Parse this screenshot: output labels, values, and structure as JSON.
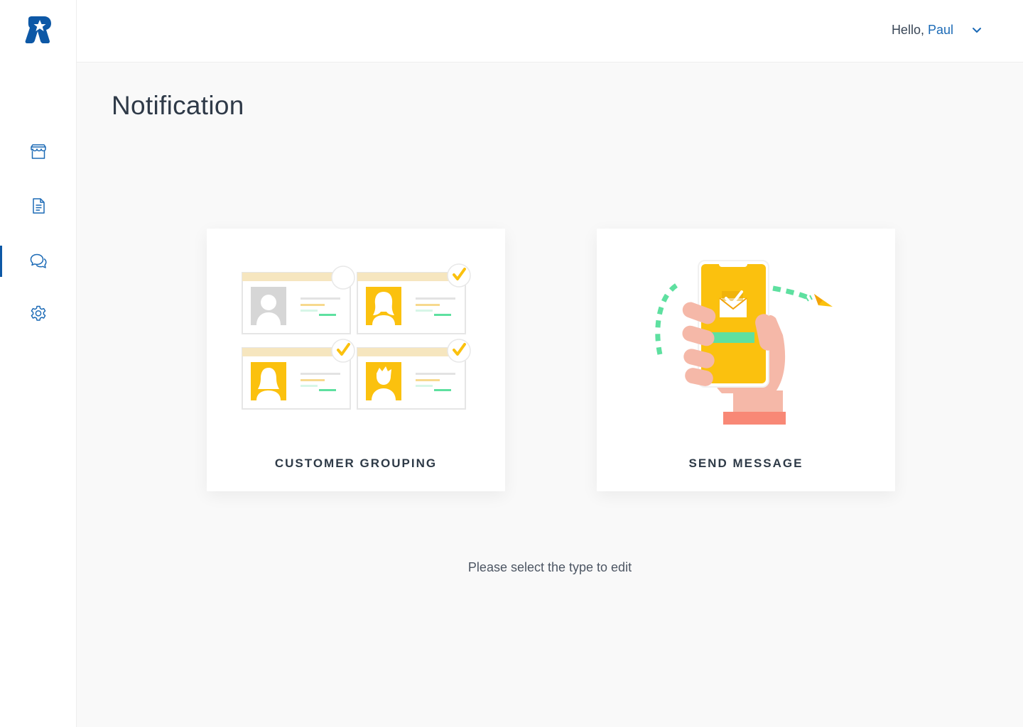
{
  "sidebar": {
    "logo_icon": "brand-star-logo",
    "items": [
      {
        "name": "store",
        "icon": "store-icon",
        "active": false
      },
      {
        "name": "document",
        "icon": "document-icon",
        "active": false
      },
      {
        "name": "chat",
        "icon": "chat-bubbles-icon",
        "active": true
      },
      {
        "name": "settings",
        "icon": "gear-icon",
        "active": false
      }
    ]
  },
  "header": {
    "greeting": "Hello,",
    "user_name": "Paul",
    "dropdown_icon": "chevron-down-icon"
  },
  "main": {
    "title": "Notification",
    "cards": [
      {
        "label": "CUSTOMER GROUPING",
        "illustration": "customer-cards-illustration"
      },
      {
        "label": "SEND MESSAGE",
        "illustration": "phone-message-illustration"
      }
    ],
    "hint": "Please select the type to edit"
  },
  "colors": {
    "accent": "#1b6ab6",
    "active_indicator": "#0d58a6",
    "yellow": "#fbc10e",
    "green": "#5ee0a0",
    "skin": "#f5b8a8",
    "coral": "#f88876"
  }
}
